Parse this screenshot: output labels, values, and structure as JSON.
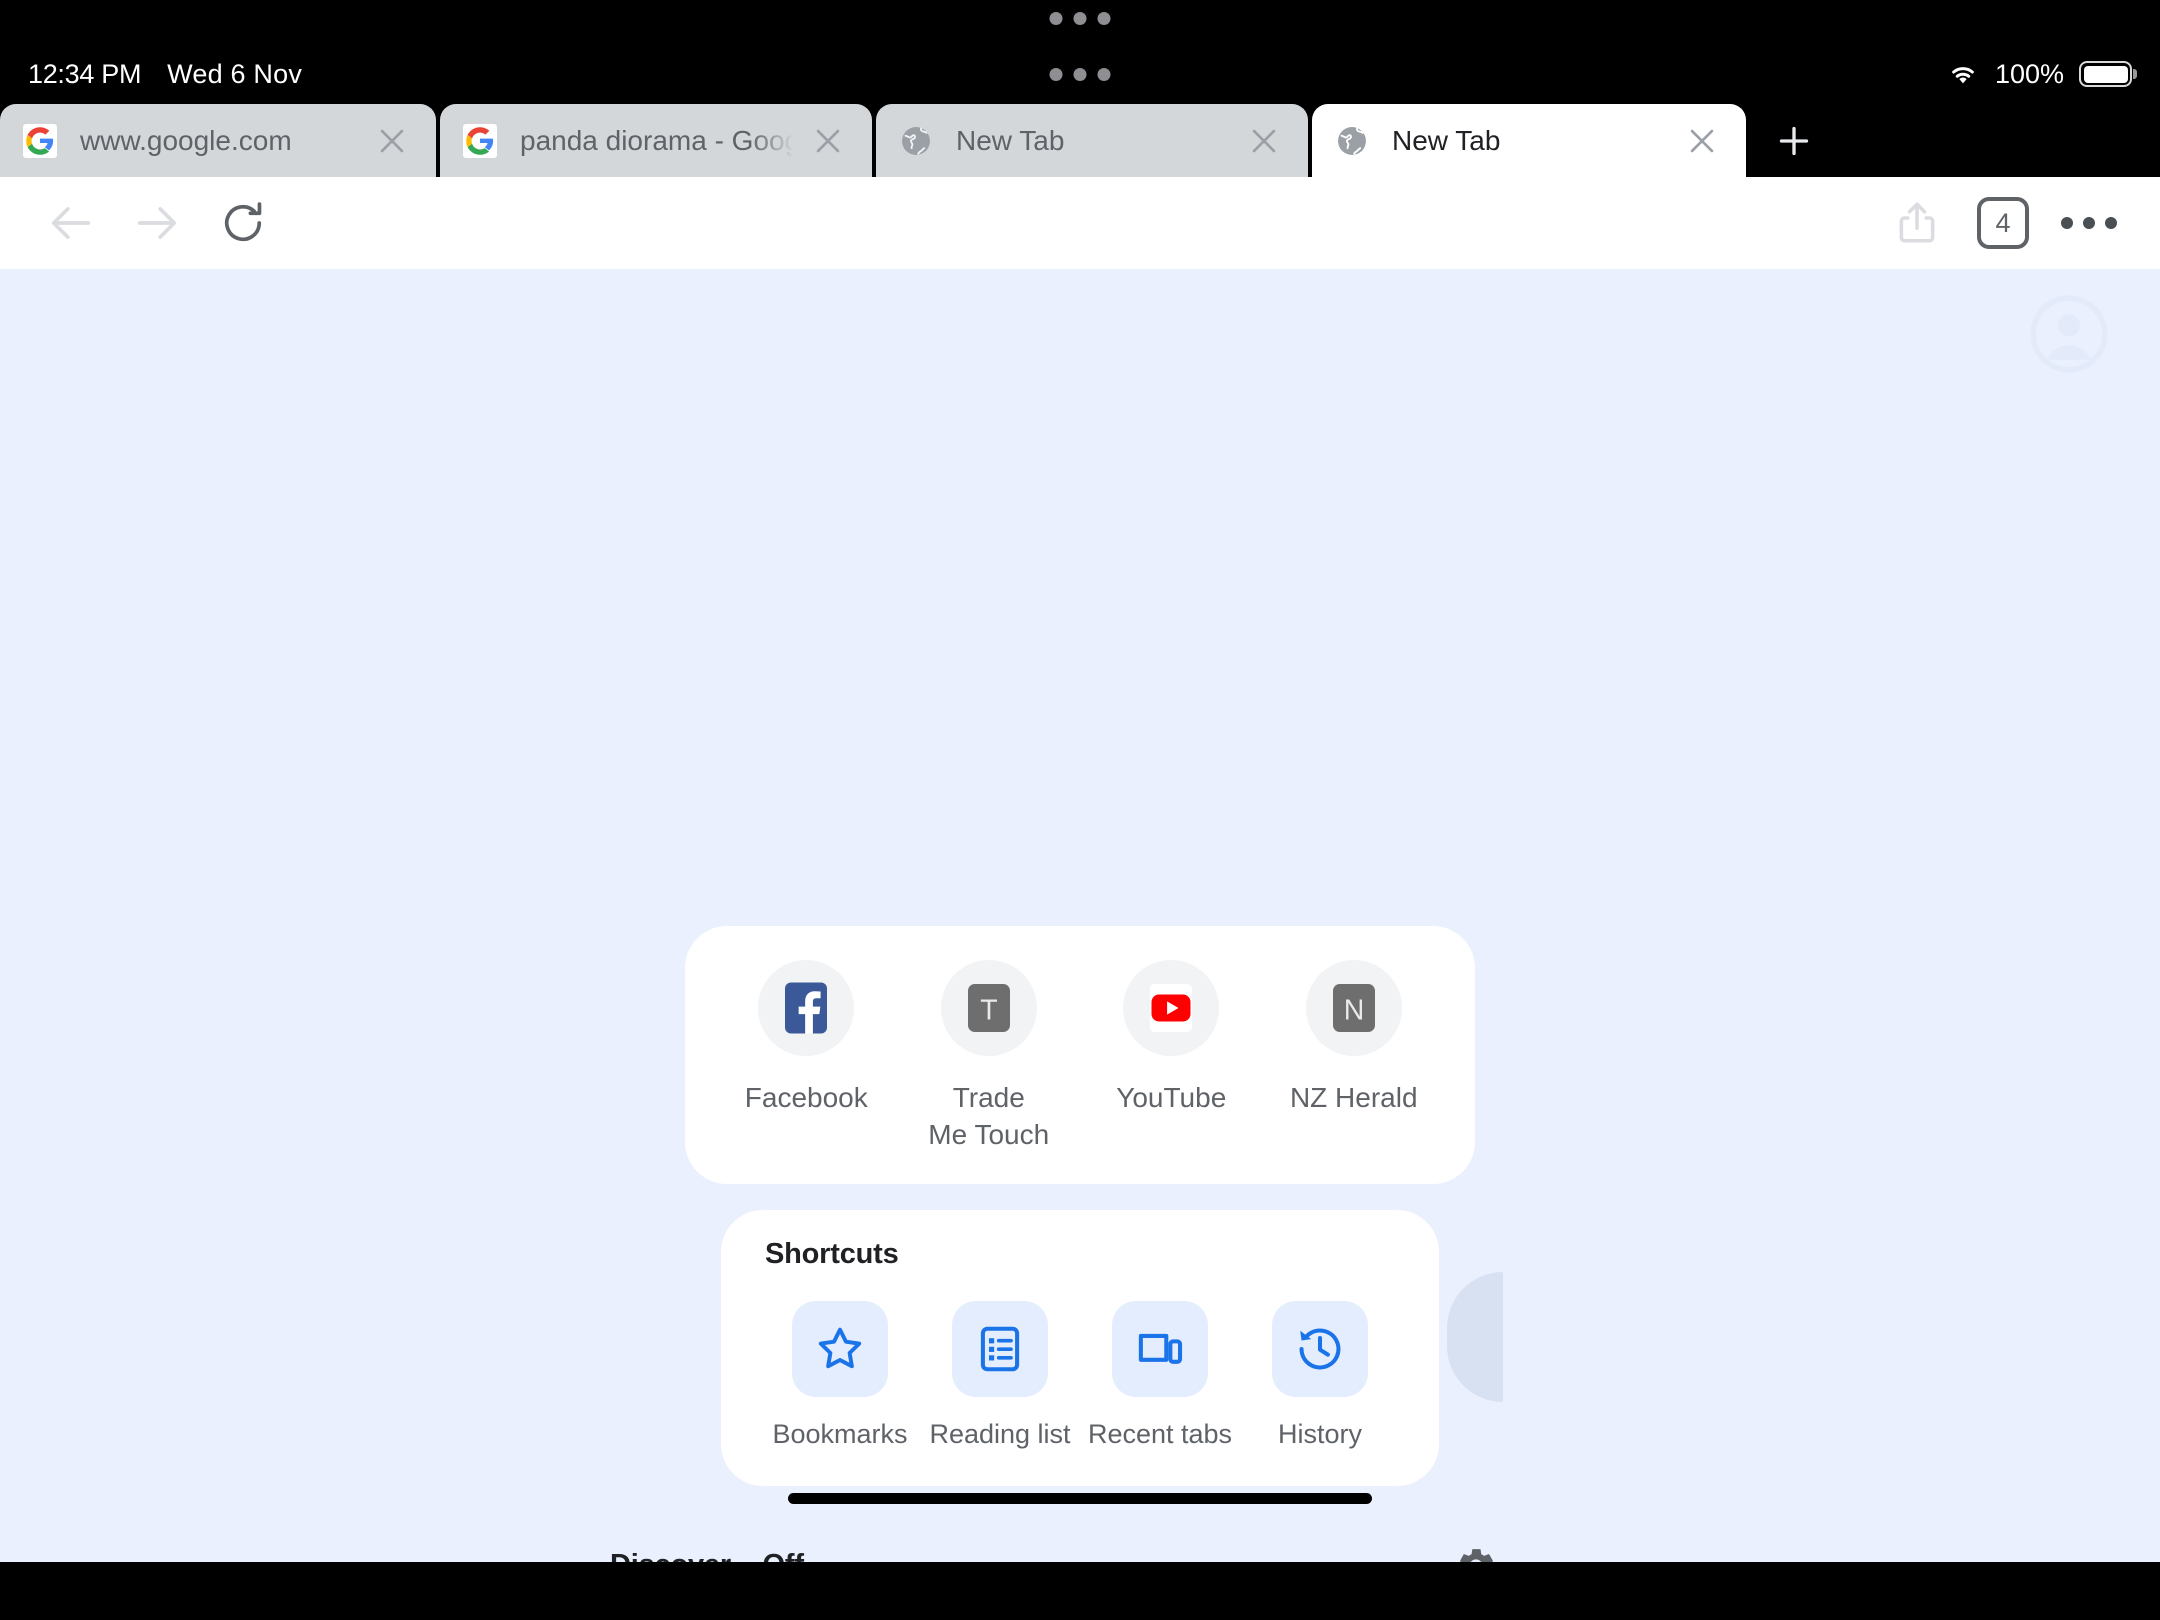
{
  "status_bar": {
    "time": "12:34 PM",
    "date": "Wed 6 Nov",
    "wifi_icon": "wifi-icon",
    "battery_percent": "100%",
    "battery_icon": "battery-full-icon"
  },
  "window_handle": {
    "top_handle_icon": "multitask-handle-dots",
    "window_handle_icon": "window-handle-dots"
  },
  "tabs": {
    "new_tab_button_label": "+",
    "items": [
      {
        "title": "www.google.com",
        "favicon": "google-favicon",
        "active": false,
        "close_icon": "close-icon"
      },
      {
        "title": "panda diorama - Google S",
        "favicon": "google-favicon",
        "active": false,
        "close_icon": "close-icon"
      },
      {
        "title": "New Tab",
        "favicon": "globe-favicon",
        "active": false,
        "close_icon": "close-icon"
      },
      {
        "title": "New Tab",
        "favicon": "globe-favicon",
        "active": true,
        "close_icon": "close-icon"
      }
    ]
  },
  "toolbar": {
    "back_icon": "back-arrow-icon",
    "forward_icon": "forward-arrow-icon",
    "reload_icon": "reload-icon",
    "share_icon": "share-icon",
    "tab_count": "4",
    "menu_icon": "more-options-icon"
  },
  "new_tab_page": {
    "account_icon": "account-avatar-icon",
    "most_visited": [
      {
        "label": "Facebook",
        "icon": "facebook-icon"
      },
      {
        "label": "Trade\nMe Touch",
        "icon": "trademe-icon",
        "letter": "T"
      },
      {
        "label": "YouTube",
        "icon": "youtube-icon"
      },
      {
        "label": "NZ Herald",
        "icon": "nzherald-icon",
        "letter": "N"
      }
    ],
    "shortcuts": {
      "title": "Shortcuts",
      "items": [
        {
          "label": "Bookmarks",
          "icon": "star-icon"
        },
        {
          "label": "Reading list",
          "icon": "reading-list-icon"
        },
        {
          "label": "Recent tabs",
          "icon": "recent-tabs-icon"
        },
        {
          "label": "History",
          "icon": "history-clock-icon"
        }
      ]
    },
    "discover": {
      "label": "Discover – Off",
      "settings_icon": "gear-icon"
    }
  },
  "colors": {
    "page_background": "#eaf0fd",
    "card_background": "#ffffff",
    "accent_blue": "#1a73e8",
    "shortcut_tile_bg": "#e3edfd",
    "inactive_tab": "#d4d7da",
    "text_secondary": "#5f6368"
  }
}
